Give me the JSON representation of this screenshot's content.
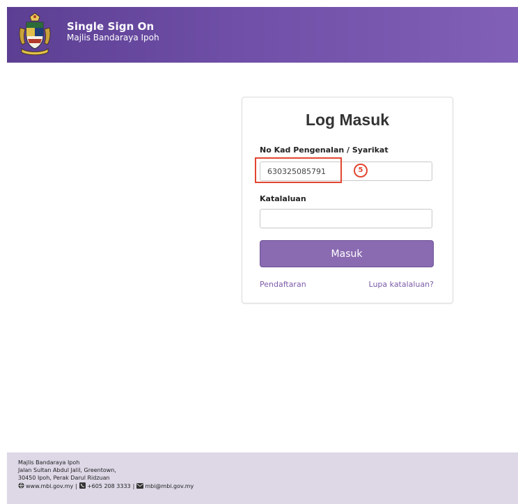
{
  "header": {
    "title": "Single Sign On",
    "subtitle": "Majlis Bandaraya Ipoh",
    "logo_icon": "mbi-coat-of-arms-icon",
    "background_color": "#6f4fa7"
  },
  "login": {
    "title": "Log Masuk",
    "ic_label": "No Kad Pengenalan / Syarikat",
    "ic_value": "630325085791",
    "password_label": "Katalaluan",
    "password_value": "",
    "submit_label": "Masuk",
    "register_link": "Pendaftaran",
    "forgot_link": "Lupa katalaluan?",
    "accent_color": "#8a6bb1"
  },
  "annotation": {
    "step_number": "5",
    "color": "#e2452f"
  },
  "footer": {
    "org_name": "Majlis Bandaraya Ipoh",
    "address_line1": "Jalan Sultan Abdul Jalil, Greentown,",
    "address_line2": "30450 Ipoh, Perak Darul Ridzuan",
    "website": "www.mbi.gov.my",
    "phone": "+605 208 3333",
    "email": "mbi@mbi.gov.my",
    "separator": "|",
    "globe_icon": "globe-icon",
    "phone_icon": "phone-icon",
    "mail_icon": "mail-icon"
  }
}
